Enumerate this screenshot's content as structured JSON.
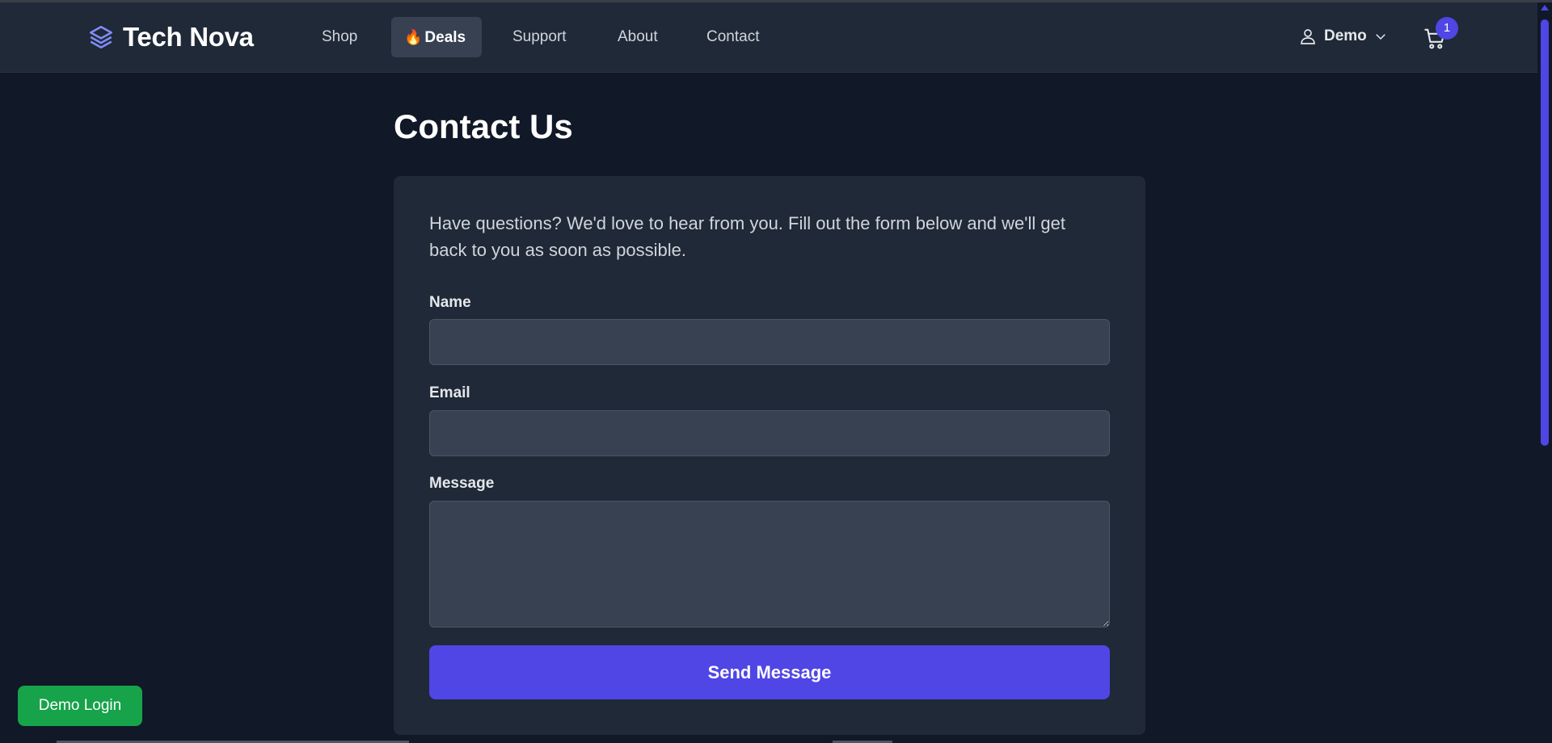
{
  "brand": {
    "name": "Tech Nova",
    "icon": "layers-icon",
    "icon_color": "#818cf8"
  },
  "nav": {
    "items": [
      {
        "label": "Shop"
      },
      {
        "label": "Deals",
        "icon": "fire-emoji",
        "active": true
      },
      {
        "label": "Support"
      },
      {
        "label": "About"
      },
      {
        "label": "Contact"
      }
    ]
  },
  "user": {
    "name": "Demo",
    "icon": "user-icon",
    "chevron": "chevron-down-icon"
  },
  "cart": {
    "icon": "cart-icon",
    "count": "1"
  },
  "page": {
    "title": "Contact Us"
  },
  "form": {
    "intro": "Have questions? We'd love to hear from you. Fill out the form below and we'll get back to you as soon as possible.",
    "name_label": "Name",
    "name_value": "",
    "email_label": "Email",
    "email_value": "",
    "message_label": "Message",
    "message_value": "",
    "submit_label": "Send Message"
  },
  "demo_login": {
    "label": "Demo Login"
  },
  "colors": {
    "background": "#111827",
    "navbar": "#1f2937",
    "card": "#1f2937",
    "input": "#374151",
    "accent": "#4f46e5",
    "demo_login": "#16a34a"
  }
}
